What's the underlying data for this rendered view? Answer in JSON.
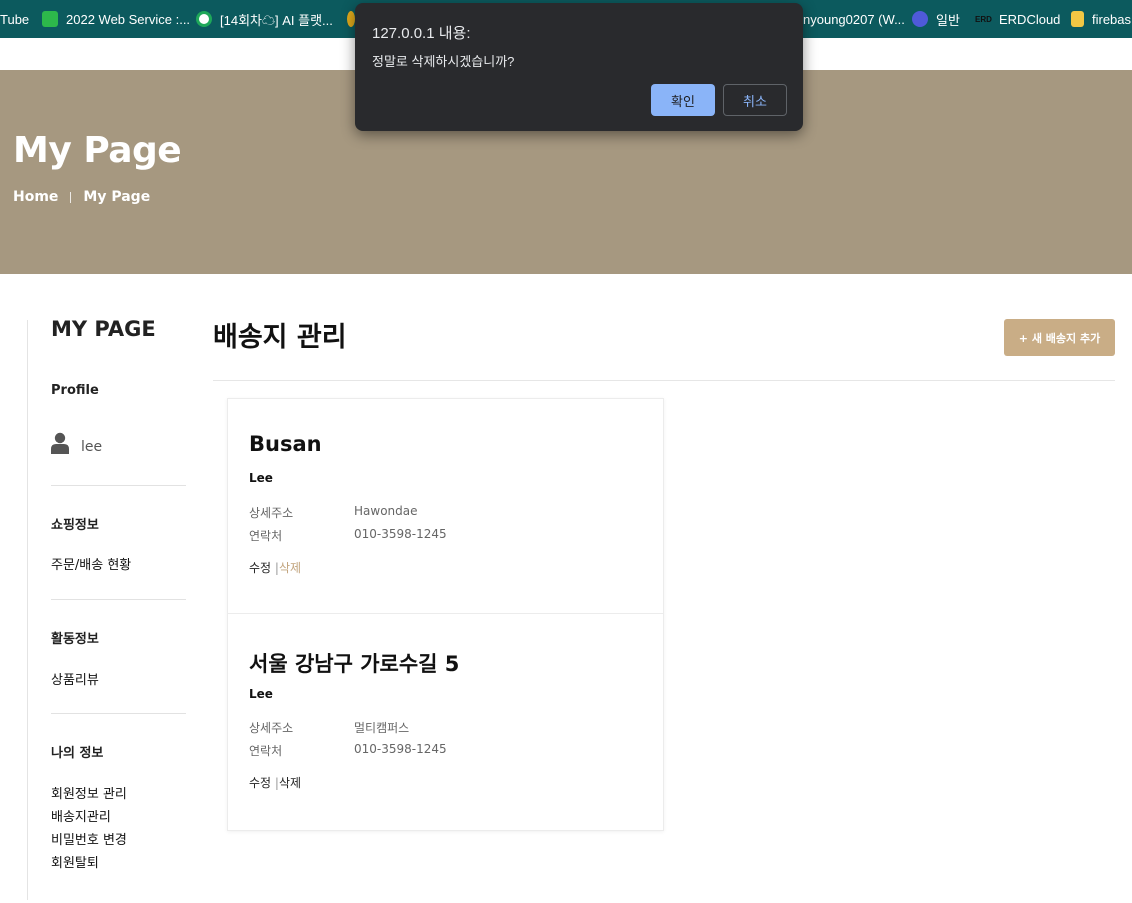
{
  "bookmarks": [
    {
      "label": "Tube",
      "icon": "youtube-icon"
    },
    {
      "label": "2022 Web Service :...",
      "icon": "gitmind-icon",
      "color": "#2db84b"
    },
    {
      "label": "[14회차☁] AI 플랫...",
      "icon": "leaf-icon",
      "color": "#1fa85a"
    },
    {
      "label": "",
      "icon": "gold-circle-icon",
      "color": "#e0a91b"
    },
    {
      "label": "nyoung0207 (W...",
      "icon": "",
      "color": ""
    },
    {
      "label": "일반",
      "icon": "chrome-profile-icon",
      "color": "#4f5ad8"
    },
    {
      "label": "ERDCloud",
      "icon": "erd-icon",
      "color": "#111111"
    },
    {
      "label": "firebas",
      "icon": "bookmark-folder-icon",
      "color": "#f2c744"
    }
  ],
  "hero": {
    "title": "My Page",
    "breadcrumb": [
      "Home",
      "My Page"
    ]
  },
  "sidebar": {
    "title": "MY PAGE",
    "profile_heading": "Profile",
    "username": "lee",
    "sections": [
      {
        "heading": "쇼핑정보",
        "links": [
          "주문/배송 현황"
        ]
      },
      {
        "heading": "활동정보",
        "links": [
          "상품리뷰"
        ]
      },
      {
        "heading": "나의 정보",
        "links": [
          "회원정보 관리",
          "배송지관리",
          "비밀번호 변경",
          "회원탈퇴"
        ]
      }
    ]
  },
  "main": {
    "title": "배송지 관리",
    "add_button": "+ 새 배송지 추가",
    "addresses": [
      {
        "title": "Busan",
        "name": "Lee",
        "detail_label": "상세주소",
        "detail": "Hawondae",
        "phone_label": "연락처",
        "phone": "010-3598-1245",
        "edit": "수정",
        "sep": "|",
        "delete": "삭제",
        "delete_color": "#c2a47d"
      },
      {
        "title": "서울 강남구 가로수길 5",
        "name": "Lee",
        "detail_label": "상세주소",
        "detail": "멀티캠퍼스",
        "phone_label": "연락처",
        "phone": "010-3598-1245",
        "edit": "수정",
        "sep": "|",
        "delete": "삭제",
        "delete_color": "#222222"
      }
    ]
  },
  "dialog": {
    "title": "127.0.0.1 내용:",
    "message": "정말로 삭제하시겠습니까?",
    "ok": "확인",
    "cancel": "취소"
  },
  "colors": {
    "bookmark_bar": "#0c5a5e",
    "hero_bg": "#a69880",
    "accent": "#c9ad86",
    "dialog_bg": "#292a2d",
    "dialog_button": "#8ab4f8"
  }
}
